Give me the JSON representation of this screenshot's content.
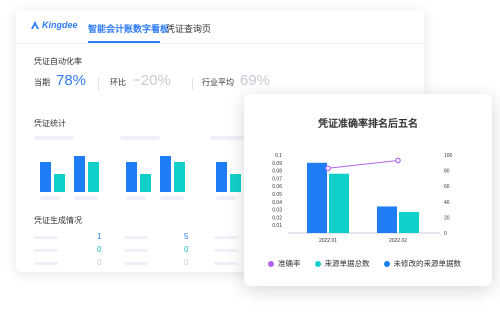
{
  "header": {
    "logo_text": "Kingdee",
    "tabs": [
      {
        "label": "智能会计账数字看板",
        "active": true
      },
      {
        "label": "凭证查询页",
        "active": false
      }
    ]
  },
  "automation": {
    "title": "凭证自动化率",
    "current": {
      "label": "当期",
      "value": "78%"
    },
    "mom": {
      "label": "环比",
      "value": "−20%"
    },
    "industry": {
      "label": "行业平均",
      "value": "69%"
    }
  },
  "stats": {
    "title": "凭证统计"
  },
  "generation": {
    "title": "凭证生成情况",
    "rows": [
      {
        "col1": "1",
        "col2": "5"
      },
      {
        "col1": "0",
        "col2": "0"
      },
      {
        "col1": "0",
        "col2": "0"
      }
    ]
  },
  "colors": {
    "accent": "#2f7cf6",
    "bar_blue": "#1e7cf5",
    "bar_teal": "#11d0c9",
    "line_purple": "#b265f0",
    "muted": "#c5cad3"
  },
  "chart_data": {
    "type": "bar",
    "title": "凭证准确率排名后五名",
    "categories": [
      "2022.01",
      "2022.02"
    ],
    "series": [
      {
        "name": "来源单据总数",
        "type": "bar",
        "axis": "left",
        "color": "#11d0c9",
        "values": [
          0.076,
          0.027
        ]
      },
      {
        "name": "未修改的来源单据数",
        "type": "bar",
        "axis": "left",
        "color": "#1e7cf5",
        "values": [
          0.09,
          0.034
        ]
      },
      {
        "name": "准确率",
        "type": "line",
        "axis": "right",
        "color": "#b265f0",
        "values": [
          83,
          93
        ]
      }
    ],
    "y_left": {
      "ticks": [
        "0.1",
        "0.09",
        "0.08",
        "0.07",
        "0.06",
        "0.05",
        "0.04",
        "0.03",
        "0.02",
        "0.01"
      ],
      "ylim": [
        0,
        0.1
      ]
    },
    "y_right": {
      "ticks": [
        "100",
        "80",
        "60",
        "40",
        "20",
        "0"
      ],
      "ylim": [
        0,
        100
      ]
    },
    "legend": {
      "placement": "bottom",
      "order": [
        "准确率",
        "来源单据总数",
        "未修改的来源单据数"
      ]
    }
  }
}
